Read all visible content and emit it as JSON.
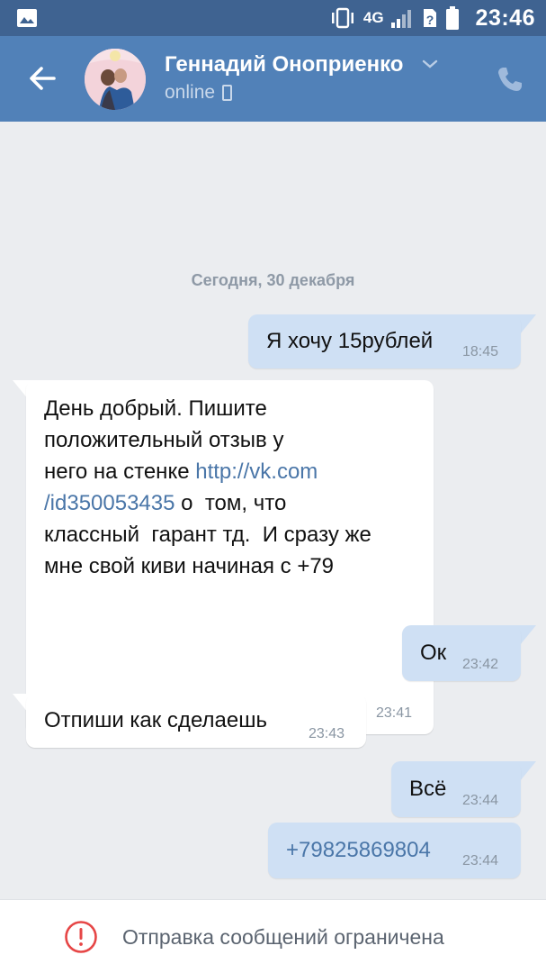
{
  "status_bar": {
    "network": "4G",
    "time": "23:46"
  },
  "header": {
    "contact_name": "Геннадий Оноприенко",
    "status": "online"
  },
  "chat": {
    "date_separator": "Сегодня, 30 декабря",
    "messages": [
      {
        "direction": "out",
        "text": "Я хочу 15рублей",
        "time": "18:45"
      },
      {
        "direction": "in",
        "lines": [
          "День добрый. Пишите",
          "положительный отзыв у",
          "него на стенке "
        ],
        "link1": "http://vk.com",
        "link2": "/id350053435",
        "after_link": " о  том, что",
        "lines2": [
          "классный  гарант тд.  И сразу же",
          "мне свой киви начиная с +79"
        ],
        "time": "23:41"
      },
      {
        "direction": "out",
        "text": "Ок",
        "time": "23:42"
      },
      {
        "direction": "in",
        "text": "Отпиши как сделаешь",
        "time": "23:43"
      },
      {
        "direction": "out",
        "text": "Всё",
        "time": "23:44"
      },
      {
        "direction": "out",
        "text": "+79825869804",
        "time": "23:44",
        "is_link": true
      }
    ]
  },
  "footer": {
    "text": "Отправка сообщений ограничена"
  },
  "colors": {
    "header": "#5181b8",
    "statusbar": "#3f6391",
    "bubble_out": "#cfe0f4",
    "bubble_in": "#ffffff",
    "link": "#4a76a8",
    "warning": "#e64646"
  }
}
